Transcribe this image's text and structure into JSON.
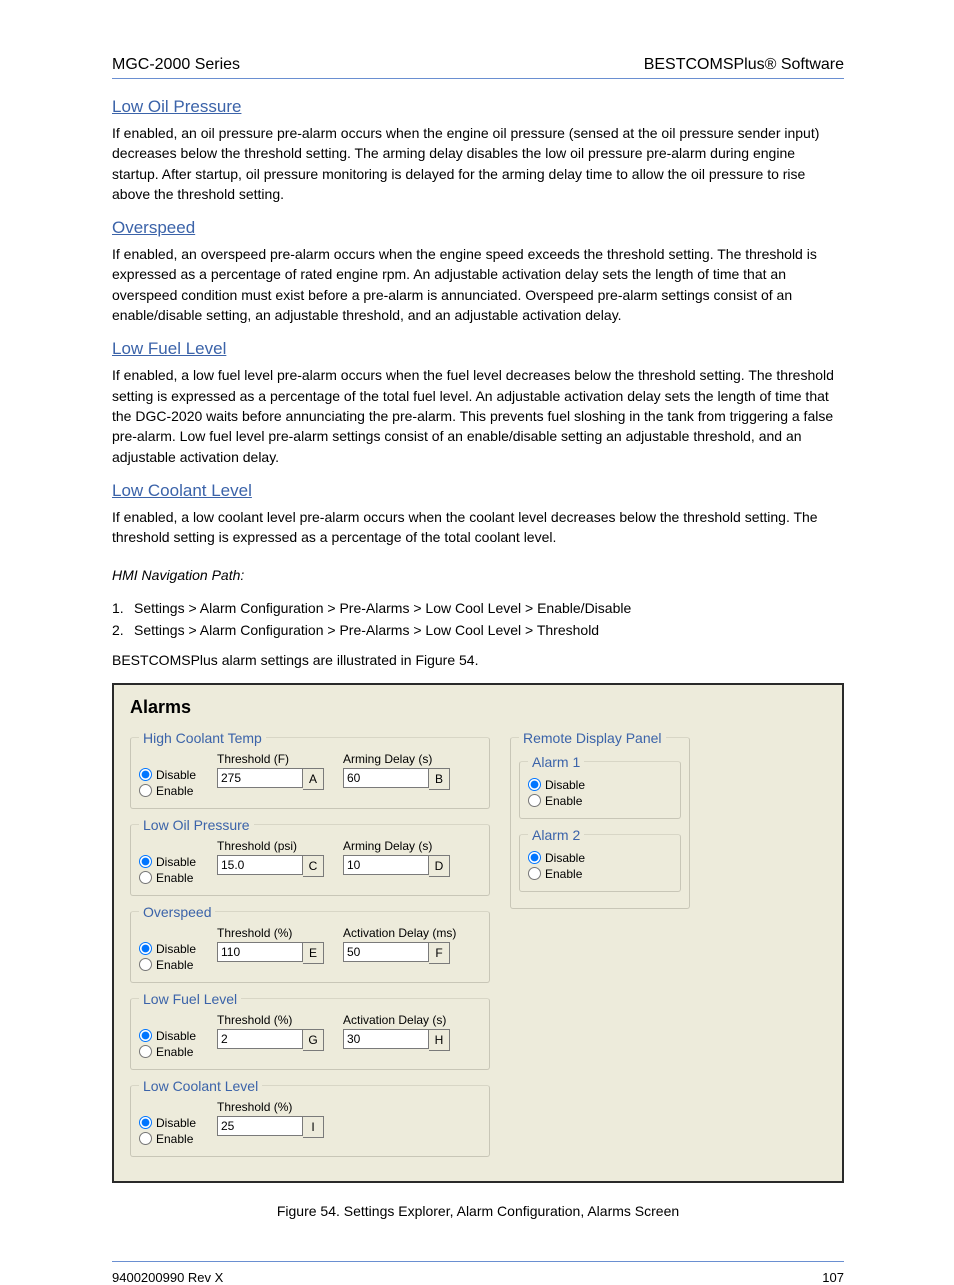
{
  "header": {
    "product": "MGC-2000 Series",
    "section": "BESTCOMSPlus® Software"
  },
  "links": {
    "low_oil": "Low Oil Pressure",
    "overspeed": "Overspeed",
    "low_fuel": "Low Fuel Level",
    "low_coolant": "Low Coolant Level"
  },
  "paras": {
    "low_oil": "If enabled, an oil pressure pre-alarm occurs when the engine oil pressure (sensed at the oil pressure sender input) decreases below the threshold setting. The arming delay disables the low oil pressure pre-alarm during engine startup. After startup, oil pressure monitoring is delayed for the arming delay time to allow the oil pressure to rise above the threshold setting.",
    "overspeed": "If enabled, an overspeed pre-alarm occurs when the engine speed exceeds the threshold setting. The threshold is expressed as a percentage of rated engine rpm. An adjustable activation delay sets the length of time that an overspeed condition must exist before a pre-alarm is annunciated. Overspeed pre-alarm settings consist of an enable/disable setting, an adjustable threshold, and an adjustable activation delay.",
    "low_fuel": "If enabled, a low fuel level pre-alarm occurs when the fuel level decreases below the threshold setting. The threshold setting is expressed as a percentage of the total fuel level. An adjustable activation delay sets the length of time that the DGC-2020 waits before annunciating the pre-alarm. This prevents fuel sloshing in the tank from triggering a false pre-alarm. Low fuel level pre-alarm settings consist of an enable/disable setting an adjustable threshold, and an adjustable activation delay.",
    "low_coolant": "If enabled, a low coolant level pre-alarm occurs when the coolant level decreases below the threshold setting. The threshold setting is expressed as a percentage of the total coolant level.",
    "bestcoms_intro": "BESTCOMSPlus alarm settings are illustrated in Figure 54.",
    "figcap": "Figure 54. Settings Explorer, Alarm Configuration, Alarms Screen"
  },
  "list": {
    "caption": "HMI Navigation Path:",
    "items": [
      "Settings > Alarm Configuration > Pre-Alarms > Low Cool Level > Enable/Disable",
      "Settings > Alarm Configuration > Pre-Alarms > Low Cool Level > Threshold"
    ]
  },
  "shot": {
    "title": "Alarms",
    "disable": "Disable",
    "enable": "Enable",
    "groups": {
      "hct": {
        "legend": "High Coolant Temp",
        "f1_label": "Threshold (F)",
        "f1_val": "275",
        "f1_mark": "A",
        "f2_label": "Arming Delay (s)",
        "f2_val": "60",
        "f2_mark": "B"
      },
      "lop": {
        "legend": "Low Oil Pressure",
        "f1_label": "Threshold (psi)",
        "f1_val": "15.0",
        "f1_mark": "C",
        "f2_label": "Arming Delay (s)",
        "f2_val": "10",
        "f2_mark": "D"
      },
      "ovs": {
        "legend": "Overspeed",
        "f1_label": "Threshold (%)",
        "f1_val": "110",
        "f1_mark": "E",
        "f2_label": "Activation Delay (ms)",
        "f2_val": "50",
        "f2_mark": "F"
      },
      "lfl": {
        "legend": "Low Fuel Level",
        "f1_label": "Threshold (%)",
        "f1_val": "2",
        "f1_mark": "G",
        "f2_label": "Activation Delay (s)",
        "f2_val": "30",
        "f2_mark": "H"
      },
      "lcl": {
        "legend": "Low Coolant Level",
        "f1_label": "Threshold (%)",
        "f1_val": "25",
        "f1_mark": "I"
      }
    },
    "rdp": {
      "legend": "Remote Display Panel",
      "a1": "Alarm 1",
      "a2": "Alarm 2"
    }
  },
  "footer": {
    "rev": "9400200990 Rev X",
    "page": "107"
  }
}
